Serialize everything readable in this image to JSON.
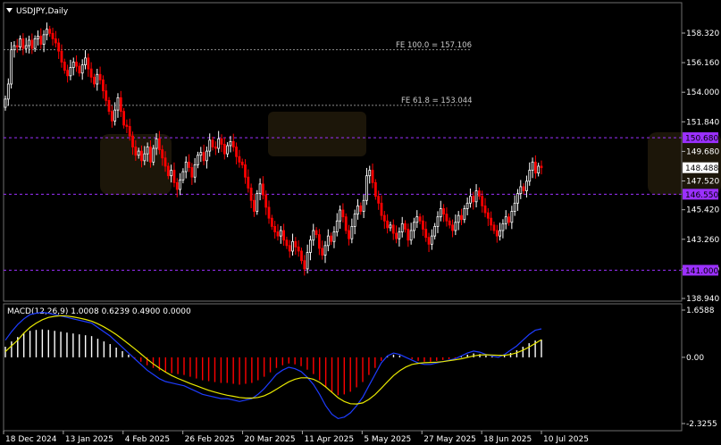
{
  "window": {
    "title": "USDJPY,Daily"
  },
  "price_panel": {
    "y_ticks": [
      "158.320",
      "156.160",
      "154.000",
      "151.840",
      "149.680",
      "147.520",
      "145.420",
      "143.260",
      "141.100",
      "138.940"
    ],
    "current_price": "148.488",
    "levels": [
      {
        "value": 150.68,
        "label": "150.680",
        "style": "dashed-purple"
      },
      {
        "value": 146.55,
        "label": "146.550",
        "style": "dashed-purple"
      },
      {
        "value": 141.0,
        "label": "141.000",
        "style": "dashed-purple"
      }
    ],
    "fib_lines": [
      {
        "value": 157.106,
        "label": "FE 100.0 = 157.106"
      },
      {
        "value": 153.044,
        "label": "FE 61.8 = 153.044"
      }
    ]
  },
  "macd_panel": {
    "header": "MACD(12,26,9) 1.0008 0.6239 0.4900 0.0000",
    "y_ticks": [
      "1.6588",
      "0.00",
      "-2.3255"
    ]
  },
  "x_ticks": [
    "18 Dec 2024",
    "13 Jan 2025",
    "4 Feb 2025",
    "26 Feb 2025",
    "20 Mar 2025",
    "11 Apr 2025",
    "5 May 2025",
    "27 May 2025",
    "18 Jun 2025",
    "10 Jul 2025"
  ],
  "colors": {
    "background": "#000000",
    "bull_candle": "#ffffff",
    "bear_candle": "#ff0000",
    "level_line": "#9b30ff",
    "fib_line": "#8c8c8c",
    "macd_hist_pos": "#ffffff",
    "macd_hist_neg": "#ff0000",
    "macd_line": "#1e3cff",
    "signal_line": "#e8e800"
  },
  "chart_data": [
    {
      "type": "candlestick",
      "title": "USDJPY,Daily",
      "ylim": [
        138.94,
        159.8
      ],
      "x": [
        "18 Dec 2024",
        "13 Jan 2025",
        "4 Feb 2025",
        "26 Feb 2025",
        "20 Mar 2025",
        "11 Apr 2025",
        "5 May 2025",
        "27 May 2025",
        "18 Jun 2025",
        "10 Jul 2025"
      ],
      "close": [
        153.5,
        154.6,
        157.1,
        157.4,
        157.3,
        157.9,
        157.2,
        157.4,
        157.8,
        157.2,
        157.9,
        158.1,
        157.5,
        158.2,
        158.6,
        158.3,
        157.9,
        157.6,
        157.0,
        156.2,
        155.6,
        155.2,
        155.8,
        156.2,
        155.9,
        155.4,
        156.0,
        156.5,
        155.7,
        155.1,
        154.6,
        155.3,
        154.9,
        154.1,
        153.4,
        152.6,
        151.9,
        152.7,
        153.6,
        152.6,
        151.6,
        151.5,
        150.8,
        150.0,
        149.4,
        149.7,
        149.0,
        149.5,
        150.0,
        148.9,
        149.9,
        150.6,
        149.8,
        149.2,
        148.6,
        147.9,
        148.3,
        147.4,
        146.9,
        147.6,
        148.2,
        148.9,
        148.5,
        147.8,
        148.7,
        149.4,
        149.6,
        149.0,
        149.7,
        150.5,
        150.0,
        149.9,
        150.6,
        150.2,
        149.5,
        150.1,
        150.4,
        150.0,
        149.3,
        148.9,
        148.7,
        147.8,
        147.0,
        146.1,
        145.3,
        146.6,
        147.3,
        146.5,
        145.6,
        144.8,
        144.2,
        143.8,
        143.5,
        143.9,
        143.2,
        142.8,
        142.4,
        143.1,
        142.7,
        142.4,
        141.7,
        141.1,
        142.3,
        143.2,
        143.9,
        143.6,
        142.6,
        142.1,
        142.8,
        143.5,
        143.1,
        143.8,
        144.6,
        145.4,
        144.9,
        143.9,
        143.3,
        144.2,
        145.1,
        145.7,
        145.3,
        146.1,
        147.9,
        148.3,
        147.4,
        146.4,
        145.9,
        145.0,
        144.6,
        144.1,
        144.3,
        143.7,
        143.3,
        143.8,
        144.4,
        144.0,
        143.2,
        143.9,
        144.5,
        144.9,
        144.6,
        144.0,
        143.4,
        142.9,
        143.5,
        144.2,
        144.9,
        145.5,
        145.1,
        144.6,
        144.3,
        143.9,
        144.5,
        145.0,
        144.7,
        145.5,
        145.9,
        146.4,
        146.0,
        146.8,
        146.4,
        145.7,
        145.2,
        144.8,
        144.3,
        143.9,
        143.5,
        143.9,
        144.4,
        144.9,
        144.5,
        145.3,
        145.9,
        146.6,
        147.1,
        146.8,
        147.5,
        148.3,
        148.9,
        148.1,
        148.6,
        148.49
      ]
    },
    {
      "type": "line",
      "title": "MACD(12,26,9) 1.0008 0.6239 0.4900 0.0000",
      "ylim": [
        -2.3255,
        1.6588
      ],
      "series": [
        {
          "name": "MACD",
          "values": [
            0.6,
            0.9,
            1.15,
            1.35,
            1.5,
            1.55,
            1.58,
            1.55,
            1.5,
            1.45,
            1.4,
            1.35,
            1.3,
            1.25,
            1.2,
            1.05,
            0.9,
            0.75,
            0.55,
            0.35,
            0.15,
            -0.05,
            -0.25,
            -0.45,
            -0.6,
            -0.75,
            -0.85,
            -0.9,
            -0.95,
            -1.0,
            -1.1,
            -1.2,
            -1.3,
            -1.35,
            -1.4,
            -1.45,
            -1.45,
            -1.5,
            -1.55,
            -1.5,
            -1.45,
            -1.3,
            -1.1,
            -0.85,
            -0.6,
            -0.45,
            -0.35,
            -0.4,
            -0.5,
            -0.7,
            -0.95,
            -1.3,
            -1.7,
            -2.0,
            -2.15,
            -2.1,
            -1.95,
            -1.7,
            -1.4,
            -1.0,
            -0.6,
            -0.2,
            0.05,
            0.15,
            0.1,
            0.0,
            -0.1,
            -0.2,
            -0.25,
            -0.25,
            -0.2,
            -0.15,
            -0.1,
            -0.05,
            0.05,
            0.15,
            0.22,
            0.18,
            0.1,
            0.05,
            0.0,
            0.1,
            0.25,
            0.4,
            0.6,
            0.8,
            0.95,
            1.0
          ]
        },
        {
          "name": "Signal",
          "values": [
            0.2,
            0.4,
            0.6,
            0.85,
            1.05,
            1.2,
            1.32,
            1.4,
            1.44,
            1.46,
            1.45,
            1.42,
            1.38,
            1.33,
            1.27,
            1.18,
            1.07,
            0.94,
            0.8,
            0.64,
            0.47,
            0.3,
            0.12,
            -0.06,
            -0.23,
            -0.38,
            -0.52,
            -0.64,
            -0.74,
            -0.83,
            -0.92,
            -1.0,
            -1.08,
            -1.16,
            -1.22,
            -1.28,
            -1.33,
            -1.37,
            -1.41,
            -1.43,
            -1.43,
            -1.41,
            -1.35,
            -1.25,
            -1.12,
            -0.99,
            -0.86,
            -0.77,
            -0.72,
            -0.72,
            -0.77,
            -0.88,
            -1.04,
            -1.23,
            -1.42,
            -1.55,
            -1.63,
            -1.64,
            -1.6,
            -1.48,
            -1.31,
            -1.09,
            -0.86,
            -0.64,
            -0.47,
            -0.34,
            -0.25,
            -0.21,
            -0.19,
            -0.18,
            -0.17,
            -0.15,
            -0.12,
            -0.09,
            -0.05,
            0.0,
            0.05,
            0.08,
            0.09,
            0.08,
            0.07,
            0.07,
            0.1,
            0.16,
            0.25,
            0.36,
            0.49,
            0.62
          ]
        }
      ]
    }
  ]
}
